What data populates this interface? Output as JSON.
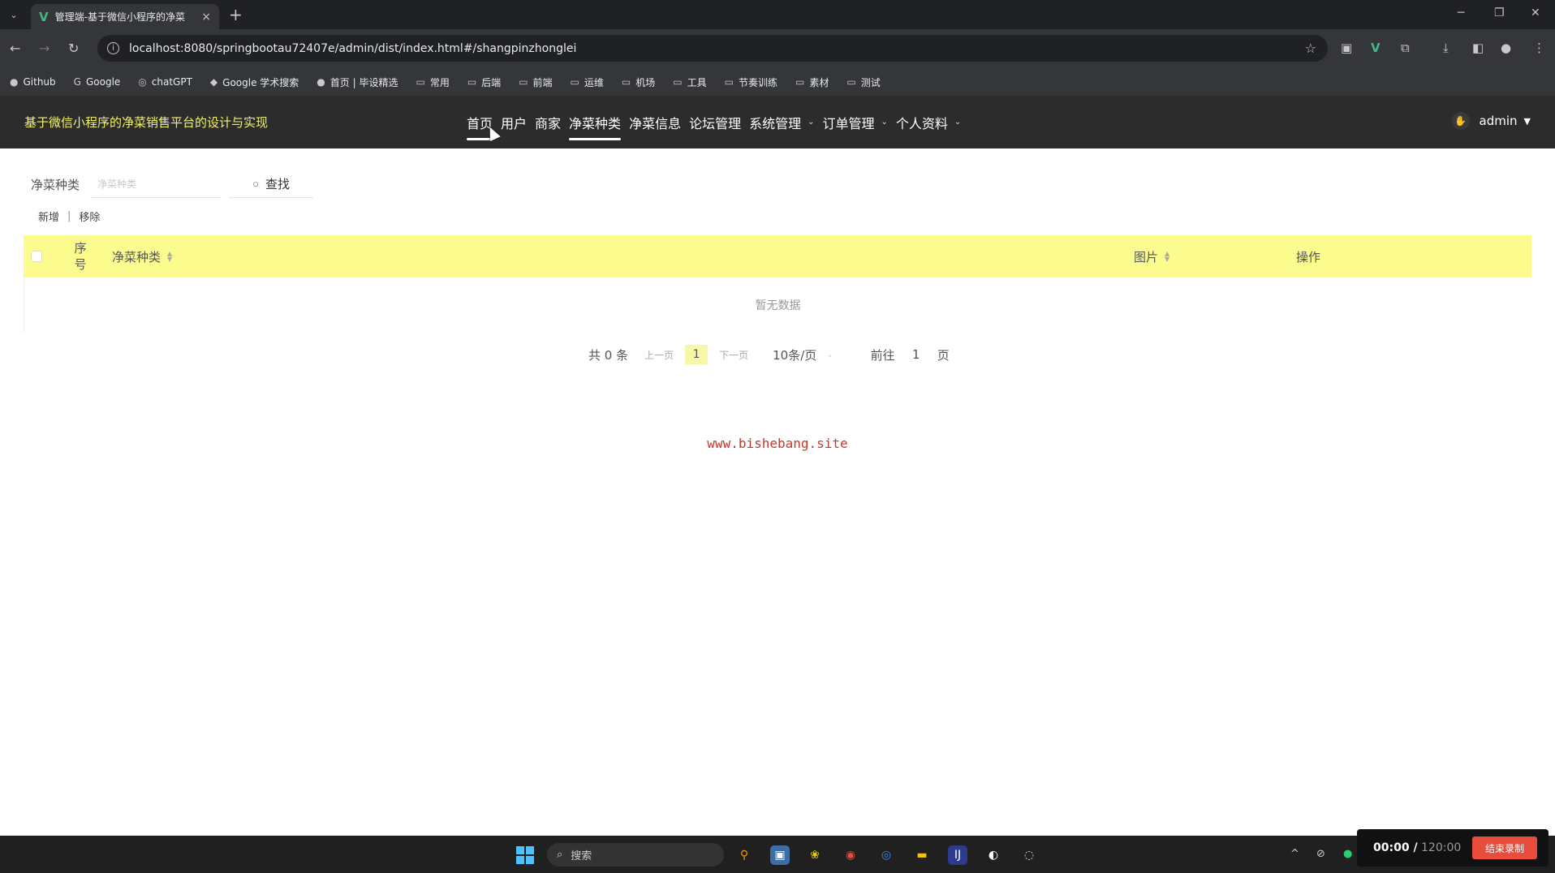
{
  "browser": {
    "tab_title": "管理端-基于微信小程序的净菜",
    "tab_close": "×",
    "new_tab": "+",
    "url": "localhost:8080/springbootau72407e/admin/dist/index.html#/shangpinzhonglei",
    "bookmarks": [
      {
        "icon": "github-icon",
        "label": "Github"
      },
      {
        "icon": "google-icon",
        "label": "Google"
      },
      {
        "icon": "chatgpt-icon",
        "label": "chatGPT"
      },
      {
        "icon": "scholar-icon",
        "label": "Google 学术搜索"
      },
      {
        "icon": "page-icon",
        "label": "首页 | 毕设精选"
      },
      {
        "icon": "folder-icon",
        "label": "常用"
      },
      {
        "icon": "folder-icon",
        "label": "后端"
      },
      {
        "icon": "folder-icon",
        "label": "前端"
      },
      {
        "icon": "folder-icon",
        "label": "运维"
      },
      {
        "icon": "folder-icon",
        "label": "机场"
      },
      {
        "icon": "folder-icon",
        "label": "工具"
      },
      {
        "icon": "folder-icon",
        "label": "节奏训练"
      },
      {
        "icon": "folder-icon",
        "label": "素材"
      },
      {
        "icon": "folder-icon",
        "label": "测试"
      }
    ]
  },
  "header": {
    "title": "基于微信小程序的净菜销售平台的设计与实现",
    "title_color": "#f3f36b",
    "nav": [
      {
        "label": "首页",
        "dropdown": false,
        "state": "hover"
      },
      {
        "label": "用户",
        "dropdown": false
      },
      {
        "label": "商家",
        "dropdown": false
      },
      {
        "label": "净菜种类",
        "dropdown": false,
        "state": "active"
      },
      {
        "label": "净菜信息",
        "dropdown": false
      },
      {
        "label": "论坛管理",
        "dropdown": false
      },
      {
        "label": "系统管理",
        "dropdown": true
      },
      {
        "label": "订单管理",
        "dropdown": true
      },
      {
        "label": "个人资料",
        "dropdown": true
      }
    ],
    "user": "admin"
  },
  "search": {
    "label": "净菜种类",
    "placeholder": "净菜种类",
    "button": "查找"
  },
  "actions": {
    "add": "新增",
    "sep": "|",
    "remove": "移除"
  },
  "table": {
    "header_bg": "#fbfb8e",
    "columns": {
      "index": "序号",
      "category": "净菜种类",
      "image": "图片",
      "operation": "操作"
    },
    "empty_text": "暂无数据"
  },
  "pagination": {
    "total": "共 0 条",
    "prev": "上一页",
    "current_page": "1",
    "next": "下一页",
    "page_size": "10条/页",
    "goto_label": "前往",
    "goto_value": "1",
    "goto_suffix": "页"
  },
  "watermark": "www.bishebang.site",
  "taskbar": {
    "search_placeholder": "搜索"
  },
  "recorder": {
    "elapsed": "00:00 /",
    "limit": " 120:00",
    "stop_button": "结束录制"
  }
}
